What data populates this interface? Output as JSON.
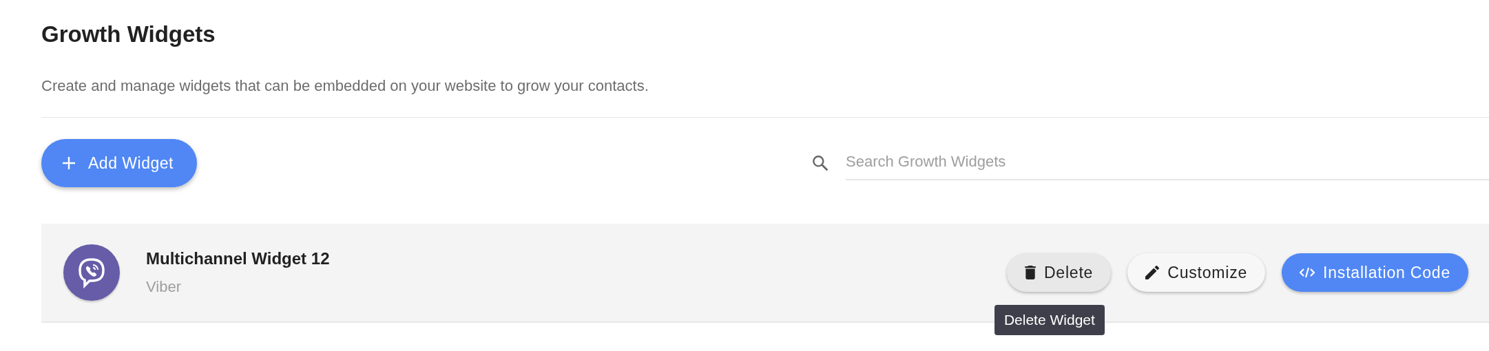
{
  "header": {
    "title": "Growth Widgets",
    "description": "Create and manage widgets that can be embedded on your website to grow your contacts."
  },
  "toolbar": {
    "add_button": "Add Widget",
    "search": {
      "placeholder": "Search Growth Widgets"
    }
  },
  "widgets": [
    {
      "name": "Multichannel Widget 12",
      "channel": "Viber",
      "color": "#665ca7",
      "actions": [
        {
          "kind": "delete",
          "label": "Delete",
          "hovered": true,
          "tooltip": "Delete Widget"
        },
        {
          "kind": "customize",
          "label": "Customize",
          "hovered": false
        },
        {
          "kind": "code",
          "label": "Installation Code",
          "hovered": false
        }
      ]
    }
  ]
}
